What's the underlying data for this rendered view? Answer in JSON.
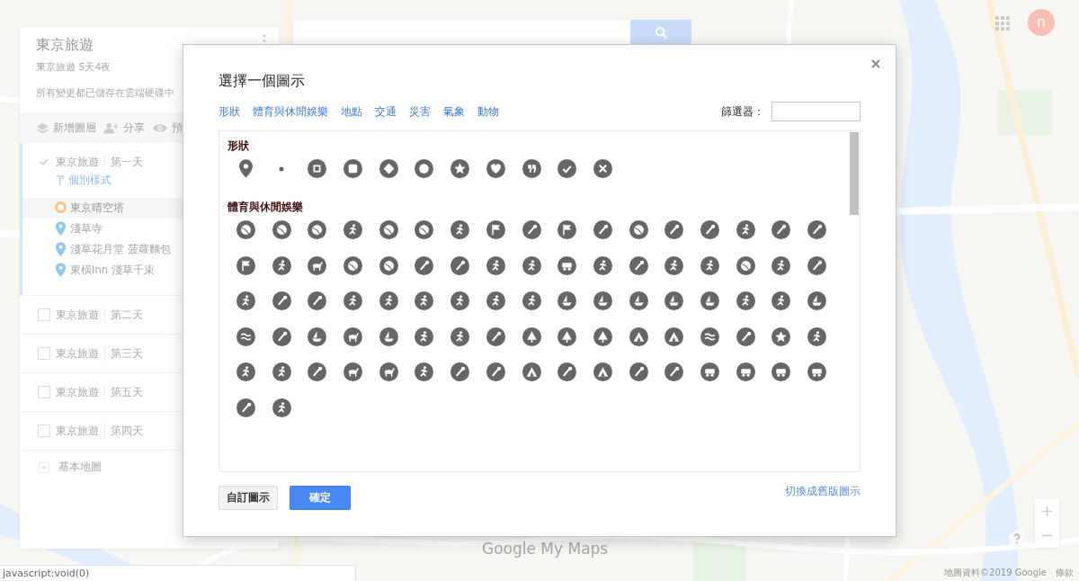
{
  "map": {
    "logo": "Google My Maps",
    "attribution": "地圖資料©2019 Google",
    "terms": "條款"
  },
  "account": {
    "initial": "n"
  },
  "panel": {
    "title": "東京旅遊",
    "subtitle": "東京旅遊 5天4夜",
    "save_status": "所有變更都已儲存在雲端硬碟中",
    "toolbar": [
      {
        "kind": "layers",
        "label": "新增圖層"
      },
      {
        "kind": "share",
        "label": "分享"
      },
      {
        "kind": "preview",
        "label": "預"
      }
    ],
    "layers": [
      {
        "name": "東京旅遊",
        "day": "第一天",
        "checked": true,
        "style": "個別樣式",
        "places": [
          {
            "name": "東京晴空塔",
            "color": "#f5c690",
            "selected": true
          },
          {
            "name": "淺草寺",
            "color": "#8fcaee",
            "selected": false
          },
          {
            "name": "淺草花月堂 菠蘿麵包",
            "color": "#8fcaee",
            "selected": false
          },
          {
            "name": "東橫Inn 淺草千束",
            "color": "#8fcaee",
            "selected": false
          }
        ]
      },
      {
        "name": "東京旅遊",
        "day": "第二天",
        "checked": false
      },
      {
        "name": "東京旅遊",
        "day": "第三天",
        "checked": false
      },
      {
        "name": "東京旅遊",
        "day": "第五天",
        "checked": false
      },
      {
        "name": "東京旅遊",
        "day": "第四天",
        "checked": false
      }
    ],
    "basemap": "基本地圖"
  },
  "dialog": {
    "title": "選擇一個圖示",
    "tabs": [
      {
        "label": "形狀"
      },
      {
        "label": "體育與休閒娛樂"
      },
      {
        "label": "地點"
      },
      {
        "label": "交通"
      },
      {
        "label": "災害"
      },
      {
        "label": "氣象"
      },
      {
        "label": "動物"
      }
    ],
    "filter": {
      "label": "篩選器："
    },
    "sections": [
      {
        "title": "形狀",
        "icons": [
          {
            "kind": "pin"
          },
          {
            "kind": "dot"
          },
          {
            "kind": "square-ring"
          },
          {
            "kind": "square"
          },
          {
            "kind": "diamond"
          },
          {
            "kind": "ring"
          },
          {
            "kind": "star"
          },
          {
            "kind": "heart"
          },
          {
            "kind": "quote"
          },
          {
            "kind": "check"
          },
          {
            "kind": "cross"
          }
        ]
      },
      {
        "title": "體育與休閒娛樂",
        "icons": [
          {
            "kind": "ball"
          },
          {
            "kind": "ball"
          },
          {
            "kind": "ball"
          },
          {
            "kind": "figure"
          },
          {
            "kind": "ball"
          },
          {
            "kind": "ball"
          },
          {
            "kind": "figure"
          },
          {
            "kind": "flag"
          },
          {
            "kind": "tool"
          },
          {
            "kind": "flag"
          },
          {
            "kind": "tool"
          },
          {
            "kind": "ball"
          },
          {
            "kind": "tool"
          },
          {
            "kind": "tool"
          },
          {
            "kind": "figure"
          },
          {
            "kind": "tool"
          },
          {
            "kind": "tool"
          },
          {
            "kind": "flag"
          },
          {
            "kind": "figure"
          },
          {
            "kind": "animal"
          },
          {
            "kind": "ball"
          },
          {
            "kind": "ball"
          },
          {
            "kind": "tool"
          },
          {
            "kind": "tool"
          },
          {
            "kind": "figure"
          },
          {
            "kind": "figure"
          },
          {
            "kind": "vehicle"
          },
          {
            "kind": "figure"
          },
          {
            "kind": "tool"
          },
          {
            "kind": "figure"
          },
          {
            "kind": "figure"
          },
          {
            "kind": "ball"
          },
          {
            "kind": "figure"
          },
          {
            "kind": "tool"
          },
          {
            "kind": "figure"
          },
          {
            "kind": "tool"
          },
          {
            "kind": "tool"
          },
          {
            "kind": "figure"
          },
          {
            "kind": "figure"
          },
          {
            "kind": "figure"
          },
          {
            "kind": "figure"
          },
          {
            "kind": "figure"
          },
          {
            "kind": "figure"
          },
          {
            "kind": "boat"
          },
          {
            "kind": "boat"
          },
          {
            "kind": "boat"
          },
          {
            "kind": "boat"
          },
          {
            "kind": "boat"
          },
          {
            "kind": "figure"
          },
          {
            "kind": "figure"
          },
          {
            "kind": "boat"
          },
          {
            "kind": "wave"
          },
          {
            "kind": "tool"
          },
          {
            "kind": "boat"
          },
          {
            "kind": "animal"
          },
          {
            "kind": "boat"
          },
          {
            "kind": "figure"
          },
          {
            "kind": "figure"
          },
          {
            "kind": "tool"
          },
          {
            "kind": "tree"
          },
          {
            "kind": "tree"
          },
          {
            "kind": "tree"
          },
          {
            "kind": "tent"
          },
          {
            "kind": "tent"
          },
          {
            "kind": "wave"
          },
          {
            "kind": "tool"
          },
          {
            "kind": "star"
          },
          {
            "kind": "figure"
          },
          {
            "kind": "figure"
          },
          {
            "kind": "figure"
          },
          {
            "kind": "tool"
          },
          {
            "kind": "animal"
          },
          {
            "kind": "animal"
          },
          {
            "kind": "figure"
          },
          {
            "kind": "tool"
          },
          {
            "kind": "tool"
          },
          {
            "kind": "tent"
          },
          {
            "kind": "tool"
          },
          {
            "kind": "tent"
          },
          {
            "kind": "tool"
          },
          {
            "kind": "tool"
          },
          {
            "kind": "vehicle"
          },
          {
            "kind": "vehicle"
          },
          {
            "kind": "vehicle"
          },
          {
            "kind": "vehicle"
          },
          {
            "kind": "tool"
          },
          {
            "kind": "figure"
          }
        ]
      }
    ],
    "buttons": [
      {
        "kind": "secondary",
        "label": "自訂圖示"
      },
      {
        "kind": "primary",
        "label": "確定"
      }
    ],
    "legacy_link": "切換成舊版圖示"
  },
  "status_bar": "javascript:void(0)"
}
